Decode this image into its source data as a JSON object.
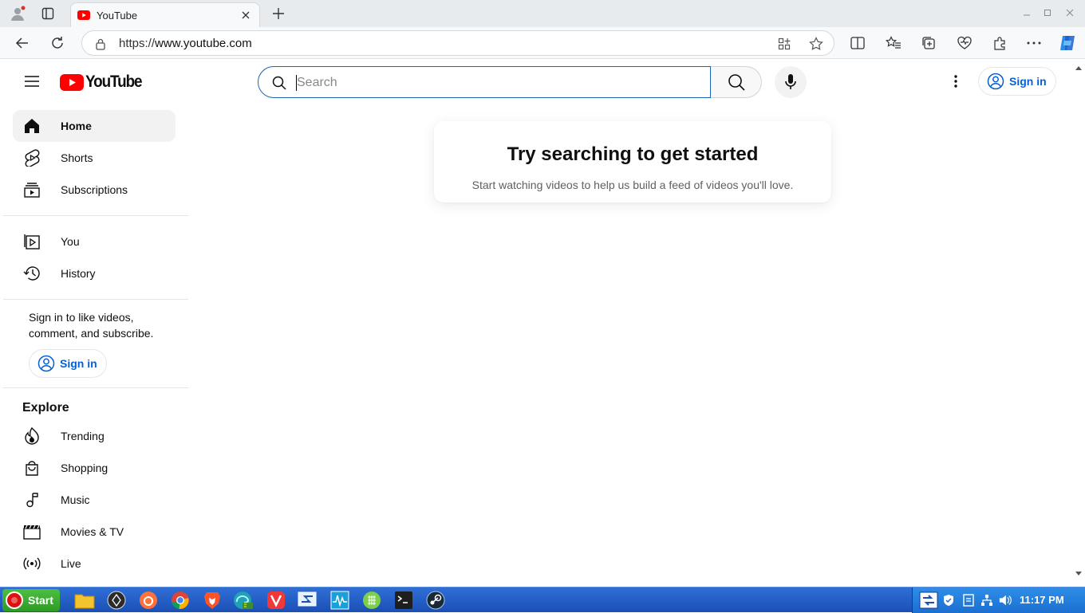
{
  "browser": {
    "tab_title": "YouTube",
    "url_prefix": "https://",
    "url_host": "www.youtube.com"
  },
  "masthead": {
    "logo_text": "YouTube",
    "search_placeholder": "Search",
    "signin_label": "Sign in"
  },
  "sidebar": {
    "primary": [
      {
        "label": "Home",
        "icon": "home-icon",
        "active": true
      },
      {
        "label": "Shorts",
        "icon": "shorts-icon"
      },
      {
        "label": "Subscriptions",
        "icon": "subscriptions-icon"
      }
    ],
    "you": [
      {
        "label": "You",
        "icon": "your-channel-icon"
      },
      {
        "label": "History",
        "icon": "history-icon"
      }
    ],
    "signin_blurb": "Sign in to like videos, comment, and subscribe.",
    "signin_label": "Sign in",
    "explore_heading": "Explore",
    "explore": [
      {
        "label": "Trending",
        "icon": "trending-icon"
      },
      {
        "label": "Shopping",
        "icon": "shopping-icon"
      },
      {
        "label": "Music",
        "icon": "music-icon"
      },
      {
        "label": "Movies & TV",
        "icon": "movies-icon"
      },
      {
        "label": "Live",
        "icon": "live-icon"
      }
    ]
  },
  "empty_state": {
    "title": "Try searching to get started",
    "subtitle": "Start watching videos to help us build a feed of videos you'll love."
  },
  "taskbar": {
    "start_label": "Start",
    "clock": "11:17 PM"
  },
  "colors": {
    "youtube_red": "#ff0000",
    "link_blue": "#065fd4",
    "taskbar_blue": "#1b4fb5"
  }
}
